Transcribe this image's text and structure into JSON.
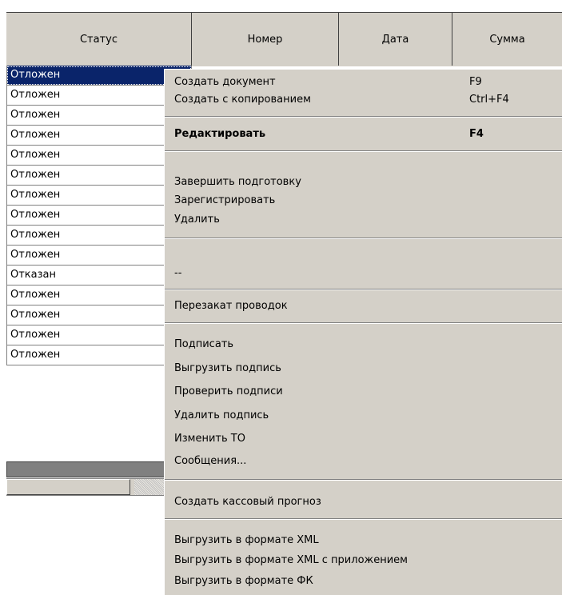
{
  "columns": [
    "Статус",
    "Номер",
    "Дата",
    "Сумма"
  ],
  "rows": [
    "Отложен",
    "Отложен",
    "Отложен",
    "Отложен",
    "Отложен",
    "Отложен",
    "Отложен",
    "Отложен",
    "Отложен",
    "Отложен",
    "Отказан",
    "Отложен",
    "Отложен",
    "Отложен",
    "Отложен"
  ],
  "menu": {
    "create_doc": "Создать документ",
    "create_doc_sc": "F9",
    "create_copy": "Создать с копированием",
    "create_copy_sc": "Ctrl+F4",
    "edit": "Редактировать",
    "edit_sc": "F4",
    "finish_prep": "Завершить подготовку",
    "register": "Зарегистрировать",
    "delete": "Удалить",
    "dashes": "--",
    "reroll_entries": "Перезакат проводок",
    "sign": "Подписать",
    "export_signature": "Выгрузить подпись",
    "check_signatures": "Проверить подписи",
    "delete_signature": "Удалить подпись",
    "change_to": "Изменить ТО",
    "messages": "Сообщения...",
    "cash_forecast": "Создать кассовый прогноз",
    "export_xml": "Выгрузить в формате XML",
    "export_xml_attach": "Выгрузить в формате XML с приложением",
    "export_fk": "Выгрузить в формате ФК"
  }
}
